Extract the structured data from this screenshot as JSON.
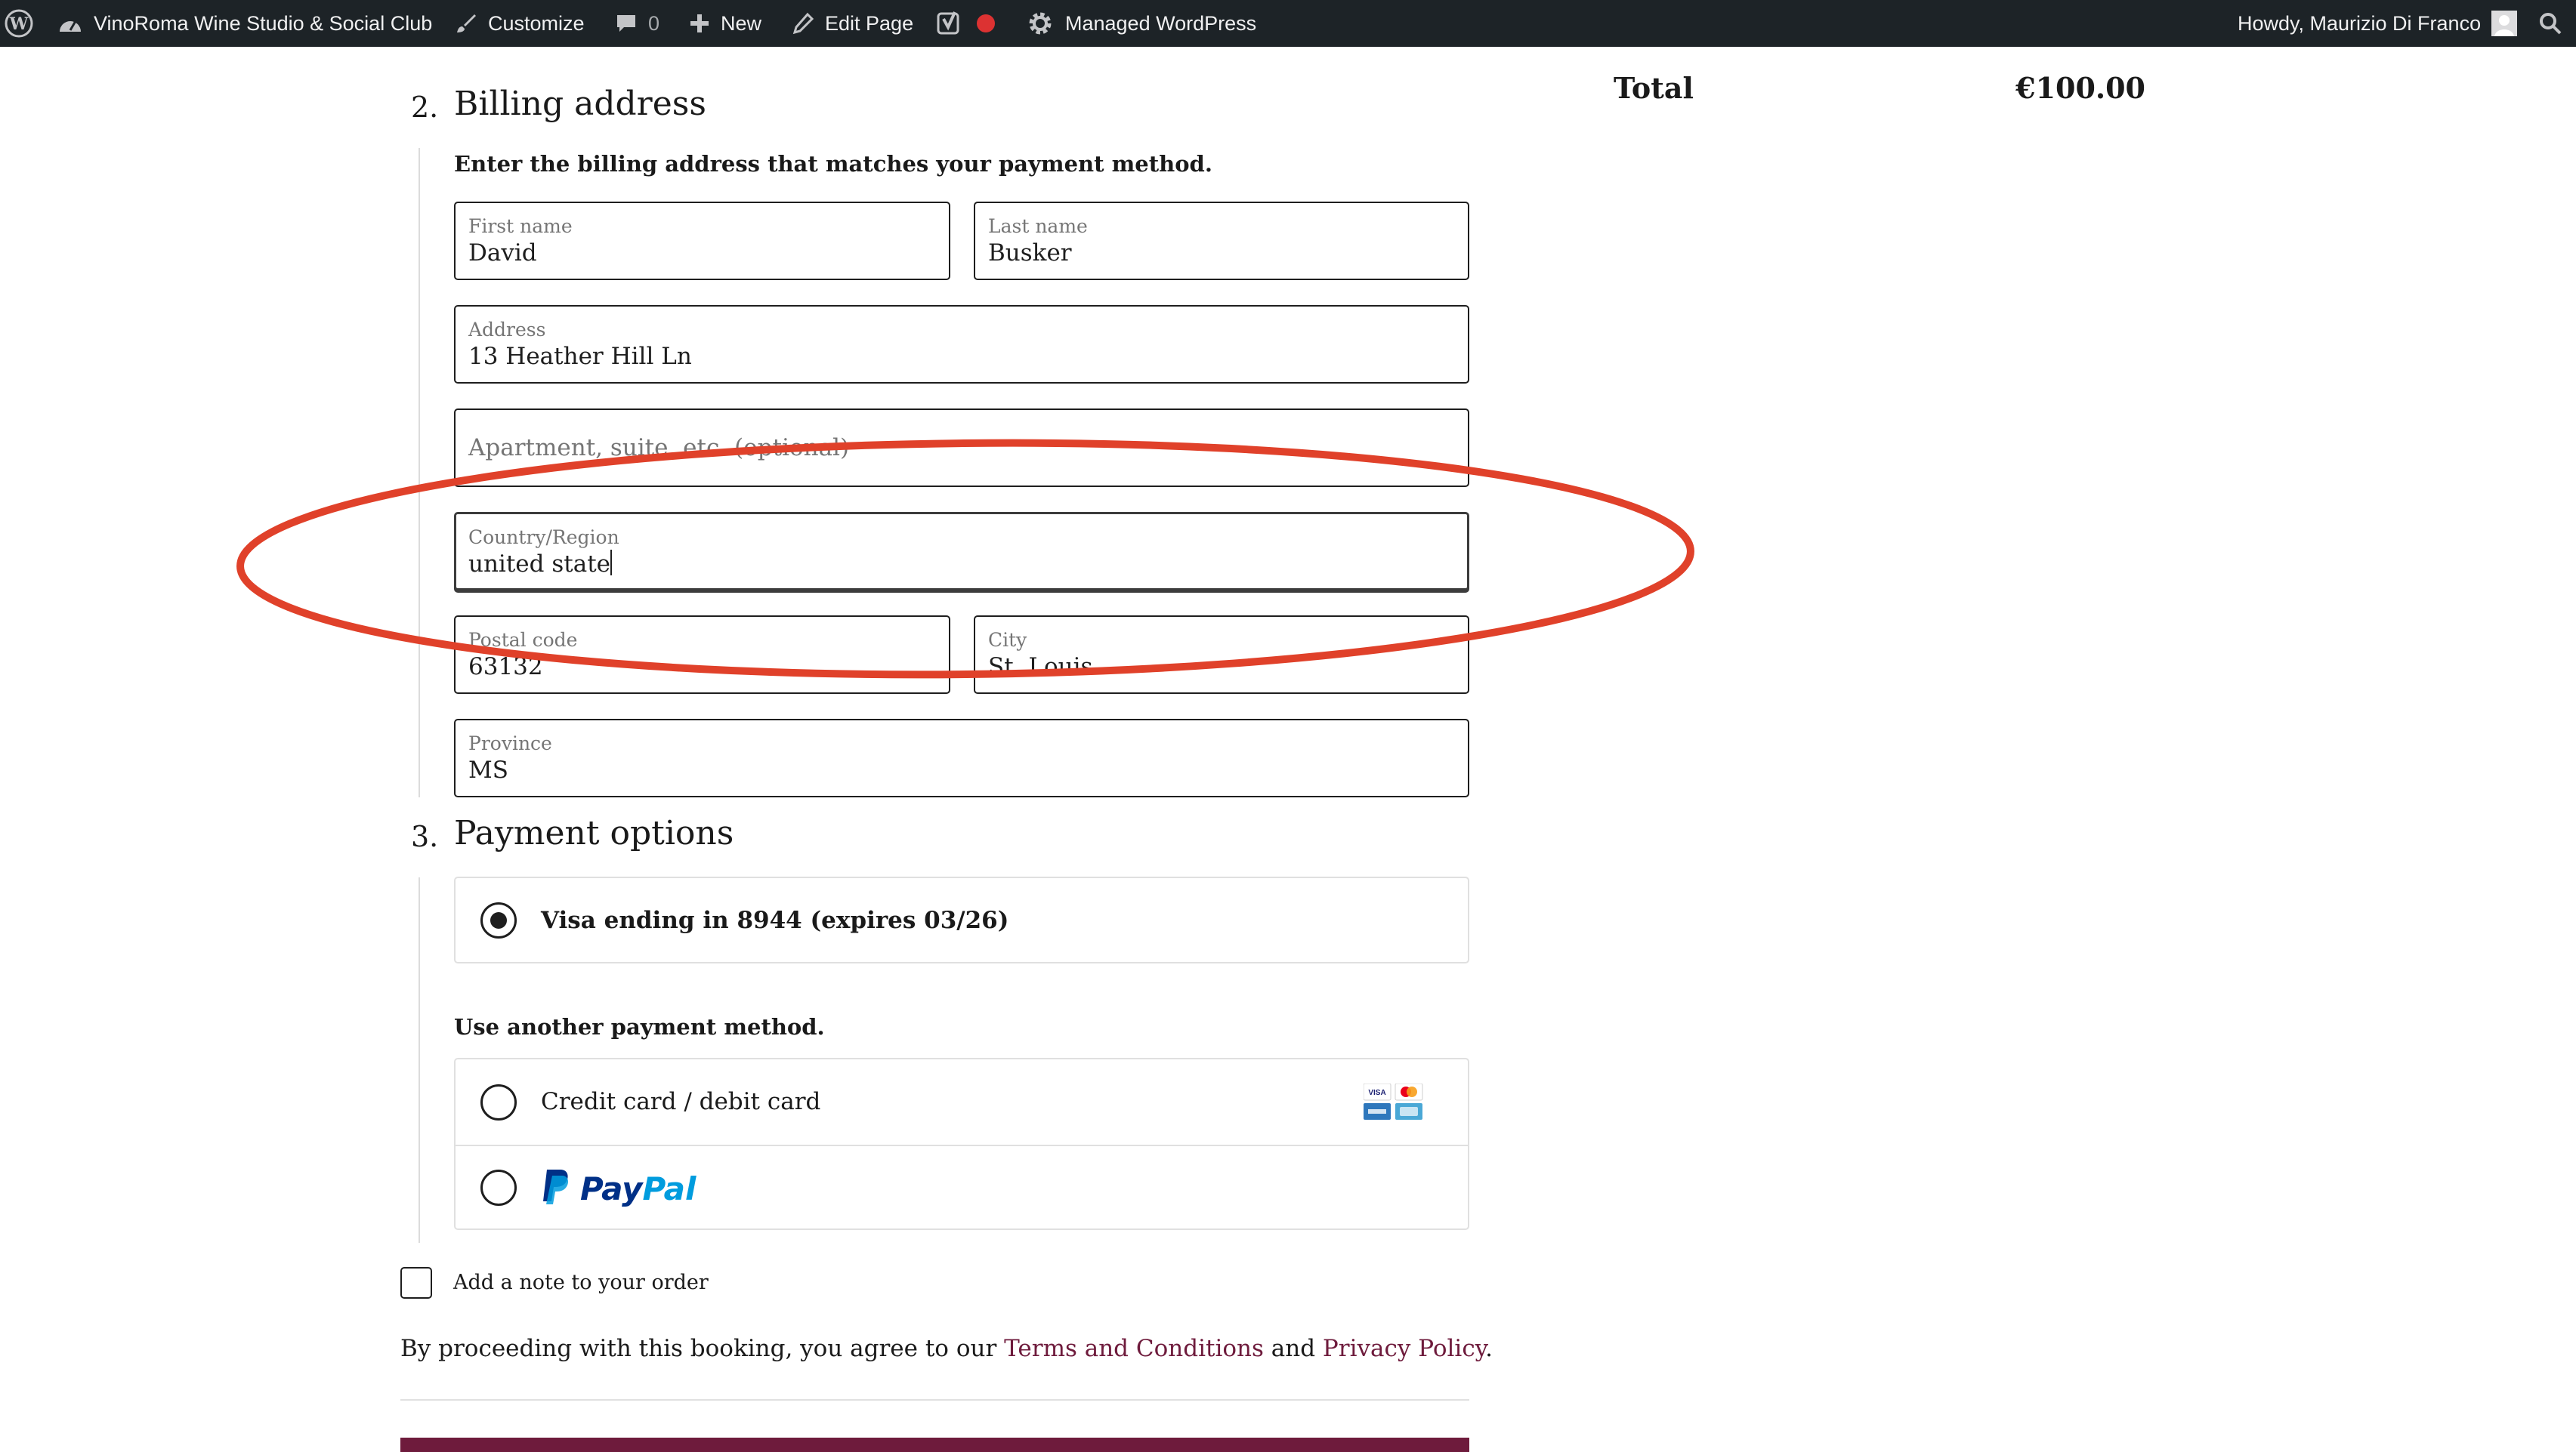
{
  "admin_bar": {
    "site_name": "VinoRoma Wine Studio & Social Club",
    "customize": "Customize",
    "comments_count": "0",
    "new": "New",
    "edit_page": "Edit Page",
    "managed": "Managed WordPress",
    "howdy": "Howdy, Maurizio Di Franco"
  },
  "summary": {
    "total_label": "Total",
    "total_value": "€100.00"
  },
  "billing": {
    "step": "2.",
    "title": "Billing address",
    "instruction": "Enter the billing address that matches your payment method.",
    "first_name": {
      "label": "First name",
      "value": "David"
    },
    "last_name": {
      "label": "Last name",
      "value": "Busker"
    },
    "address": {
      "label": "Address",
      "value": "13 Heather Hill Ln"
    },
    "address2": {
      "placeholder": "Apartment, suite, etc. (optional)"
    },
    "country": {
      "label": "Country/Region",
      "value": "united state"
    },
    "postal": {
      "label": "Postal code",
      "value": "63132"
    },
    "city": {
      "label": "City",
      "value": "St. Louis"
    },
    "province": {
      "label": "Province",
      "value": "MS"
    }
  },
  "payment": {
    "step": "3.",
    "title": "Payment options",
    "saved_card": "Visa ending in 8944 (expires 03/26)",
    "another_method": "Use another payment method.",
    "credit_card": "Credit card / debit card",
    "paypal_pay": "Pay",
    "paypal_pal": "Pal",
    "card_visa": "VISA"
  },
  "note": {
    "label": "Add a note to your order"
  },
  "terms": {
    "prefix": "By proceeding with this booking, you agree to our ",
    "terms_link": "Terms and Conditions",
    "and": " and ",
    "privacy_link": "Privacy Policy",
    "suffix": "."
  },
  "colors": {
    "accent": "#6e1b3c",
    "annotation": "#e0412a",
    "admin_bar": "#1d2327"
  }
}
